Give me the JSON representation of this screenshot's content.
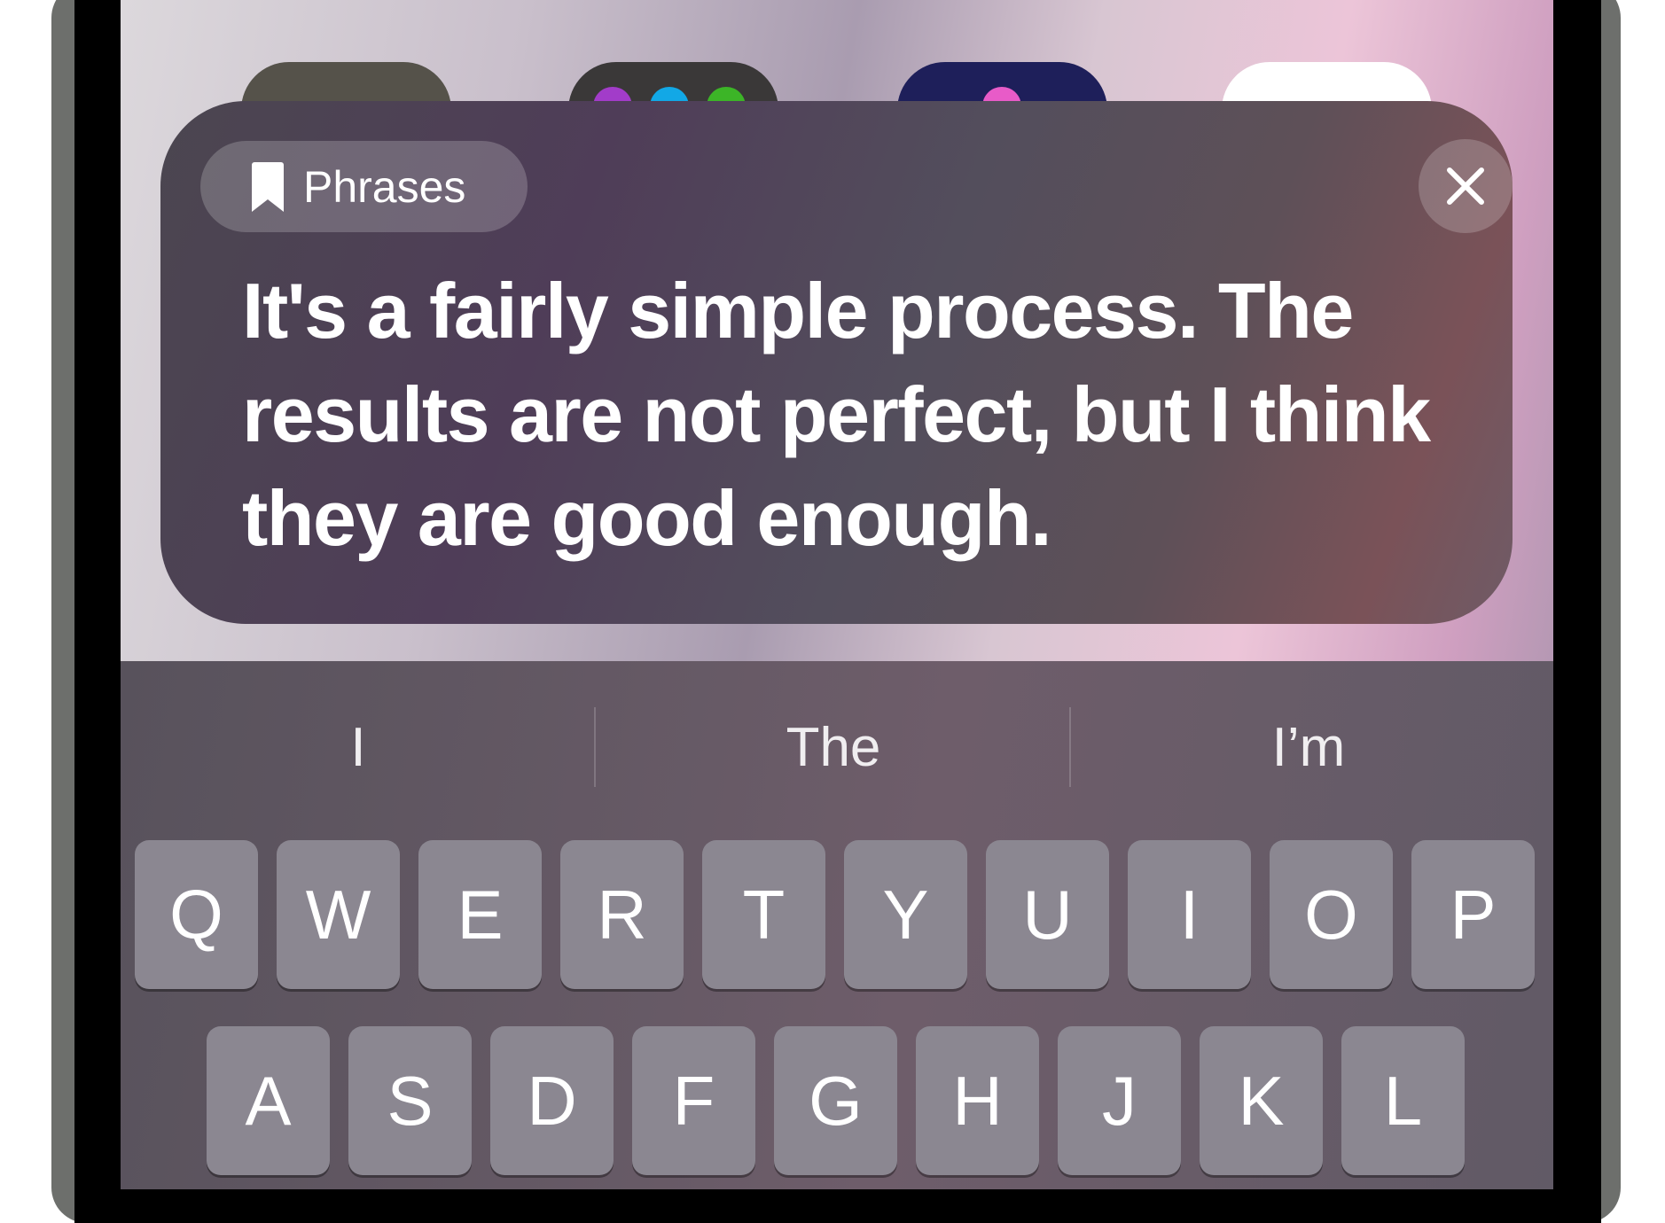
{
  "home_icons": [
    {
      "name": "app-icon-1",
      "color": "#55524a"
    },
    {
      "name": "app-icon-2",
      "color": "#3a3838",
      "dots": [
        "#a23cc9",
        "#12a8e6",
        "#3cb527"
      ]
    },
    {
      "name": "app-icon-3",
      "color": "#1e1f5a",
      "dots": [
        "#e85bc8"
      ]
    },
    {
      "name": "app-icon-4",
      "color": "#ffffff"
    }
  ],
  "card": {
    "category_label": "Phrases",
    "category_icon": "bookmark-icon",
    "close_icon": "close-icon",
    "phrase": "It's a fairly simple process. The results are not perfect, but I think they are good enough."
  },
  "keyboard": {
    "suggestions": [
      "I",
      "The",
      "I’m"
    ],
    "row1": [
      "Q",
      "W",
      "E",
      "R",
      "T",
      "Y",
      "U",
      "I",
      "O",
      "P"
    ],
    "row2": [
      "A",
      "S",
      "D",
      "F",
      "G",
      "H",
      "J",
      "K",
      "L"
    ]
  }
}
